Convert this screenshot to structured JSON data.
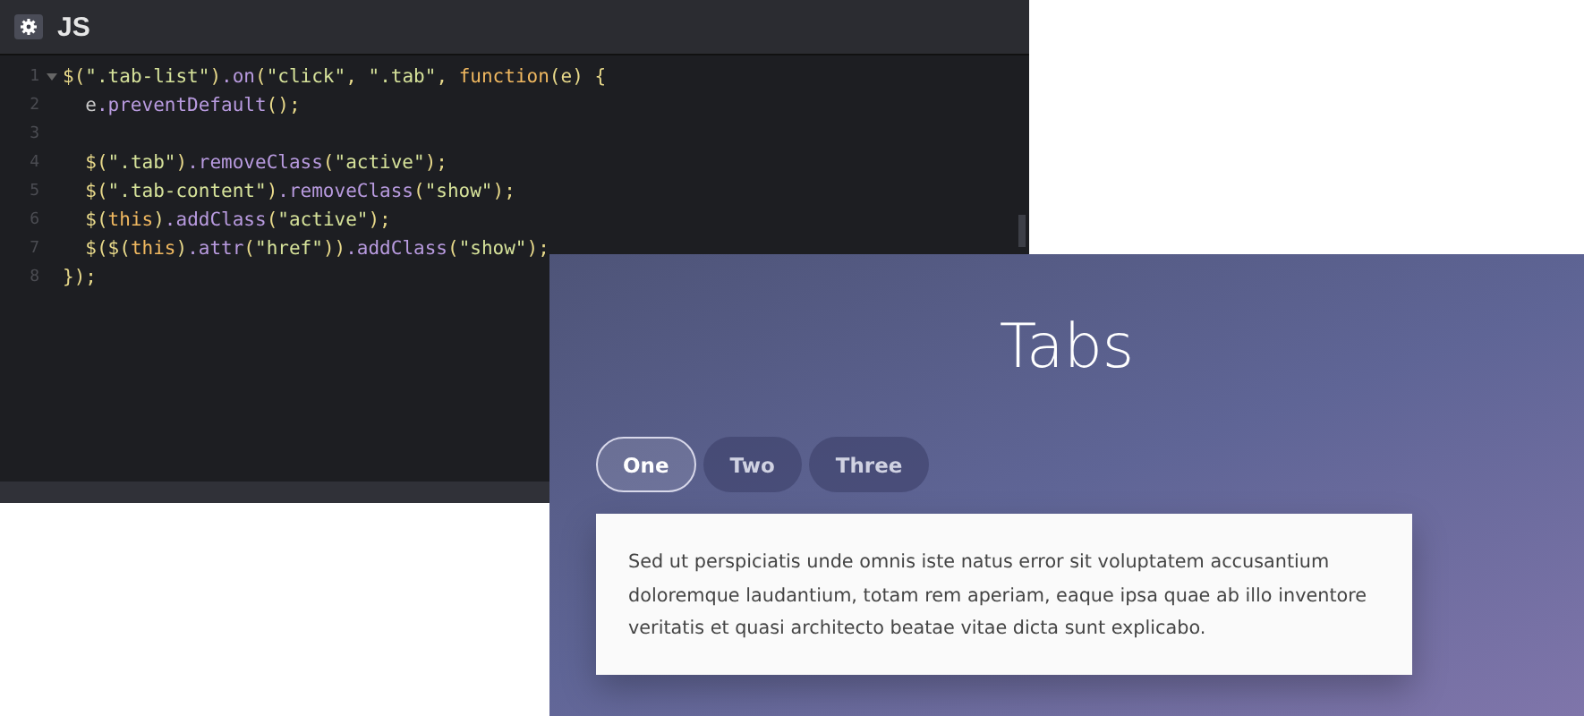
{
  "editor": {
    "title": "JS",
    "lines": [
      {
        "number": "1",
        "foldable": true,
        "tokens": [
          {
            "kind": "punct",
            "text": "$("
          },
          {
            "kind": "string",
            "text": "\".tab-list\""
          },
          {
            "kind": "punct",
            "text": ")"
          },
          {
            "kind": "method",
            "text": ".on"
          },
          {
            "kind": "punct",
            "text": "("
          },
          {
            "kind": "string",
            "text": "\"click\""
          },
          {
            "kind": "punct",
            "text": ", "
          },
          {
            "kind": "string",
            "text": "\".tab\""
          },
          {
            "kind": "punct",
            "text": ", "
          },
          {
            "kind": "keyword",
            "text": "function"
          },
          {
            "kind": "punct",
            "text": "(e) {"
          }
        ]
      },
      {
        "number": "2",
        "tokens": [
          {
            "kind": "plain",
            "text": "  e"
          },
          {
            "kind": "method",
            "text": ".preventDefault"
          },
          {
            "kind": "punct",
            "text": "();"
          }
        ]
      },
      {
        "number": "3"
      },
      {
        "number": "4",
        "tokens": [
          {
            "kind": "punct",
            "text": "  $("
          },
          {
            "kind": "string",
            "text": "\".tab\""
          },
          {
            "kind": "punct",
            "text": ")"
          },
          {
            "kind": "method",
            "text": ".removeClass"
          },
          {
            "kind": "punct",
            "text": "("
          },
          {
            "kind": "string",
            "text": "\"active\""
          },
          {
            "kind": "punct",
            "text": ");"
          }
        ]
      },
      {
        "number": "5",
        "tokens": [
          {
            "kind": "punct",
            "text": "  $("
          },
          {
            "kind": "string",
            "text": "\".tab-content\""
          },
          {
            "kind": "punct",
            "text": ")"
          },
          {
            "kind": "method",
            "text": ".removeClass"
          },
          {
            "kind": "punct",
            "text": "("
          },
          {
            "kind": "string",
            "text": "\"show\""
          },
          {
            "kind": "punct",
            "text": ");"
          }
        ]
      },
      {
        "number": "6",
        "tokens": [
          {
            "kind": "punct",
            "text": "  $("
          },
          {
            "kind": "keyword",
            "text": "this"
          },
          {
            "kind": "punct",
            "text": ")"
          },
          {
            "kind": "method",
            "text": ".addClass"
          },
          {
            "kind": "punct",
            "text": "("
          },
          {
            "kind": "string",
            "text": "\"active\""
          },
          {
            "kind": "punct",
            "text": ");"
          }
        ]
      },
      {
        "number": "7",
        "tokens": [
          {
            "kind": "punct",
            "text": "  $($("
          },
          {
            "kind": "keyword",
            "text": "this"
          },
          {
            "kind": "punct",
            "text": ")"
          },
          {
            "kind": "method",
            "text": ".attr"
          },
          {
            "kind": "punct",
            "text": "("
          },
          {
            "kind": "string",
            "text": "\"href\""
          },
          {
            "kind": "punct",
            "text": "))"
          },
          {
            "kind": "method",
            "text": ".addClass"
          },
          {
            "kind": "punct",
            "text": "("
          },
          {
            "kind": "string",
            "text": "\"show\""
          },
          {
            "kind": "punct",
            "text": ");"
          }
        ]
      },
      {
        "number": "8",
        "tokens": [
          {
            "kind": "punct",
            "text": "});"
          }
        ]
      }
    ]
  },
  "demo": {
    "heading": "Tabs",
    "tabs": [
      {
        "label": "One",
        "selected": true
      },
      {
        "label": "Two",
        "selected": false
      },
      {
        "label": "Three",
        "selected": false
      }
    ],
    "content": "Sed ut perspiciatis unde omnis iste natus error sit voluptatem accusantium doloremque laudantium, totam rem aperiam, eaque ipsa quae ab illo inventore veritatis et quasi architecto beatae vitae dicta sunt explicabo."
  }
}
